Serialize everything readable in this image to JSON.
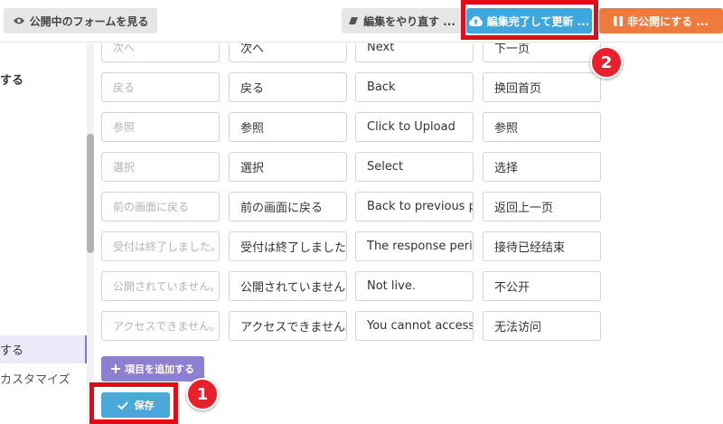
{
  "toolbar": {
    "view_public_form": "公開中のフォームを見る",
    "redo_edit": "編集をやり直す ...",
    "finish_update": "編集完了して更新 ...",
    "make_private": "非公開にする ..."
  },
  "sidebar": {
    "title": "する",
    "active_item": "する",
    "item": "カスタマイズ"
  },
  "rows": [
    {
      "placeholder": "次へ",
      "ja": "次へ",
      "en": "Next",
      "zh": "下一页"
    },
    {
      "placeholder": "戻る",
      "ja": "戻る",
      "en": "Back",
      "zh": "换回首页"
    },
    {
      "placeholder": "参照",
      "ja": "参照",
      "en": "Click to Upload",
      "zh": "参照"
    },
    {
      "placeholder": "選択",
      "ja": "選択",
      "en": "Select",
      "zh": "选择"
    },
    {
      "placeholder": "前の画面に戻る",
      "ja": "前の画面に戻る",
      "en": "Back to previous pa",
      "zh": "返回上一页"
    },
    {
      "placeholder": "受付は終了しました。",
      "ja": "受付は終了しました。",
      "en": "The response perio",
      "zh": "接待已经结束"
    },
    {
      "placeholder": "公開されていません。",
      "ja": "公開されていません。",
      "en": "Not live.",
      "zh": "不公开"
    },
    {
      "placeholder": "アクセスできません。",
      "ja": "アクセスできません。",
      "en": "You cannot access",
      "zh": "无法访问"
    }
  ],
  "add_item_label": "項目を追加する",
  "save_label": "保存",
  "annotations": {
    "badge1": "1",
    "badge2": "2"
  },
  "colors": {
    "update": "#3ea7dd",
    "private": "#ef7a3e",
    "add": "#8f7fd2",
    "save": "#4aa9d8",
    "highlight": "#e30b17"
  }
}
